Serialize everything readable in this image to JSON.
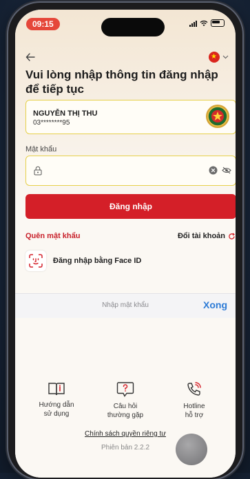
{
  "status_bar": {
    "time": "09:15"
  },
  "header": {
    "language_flag": "vietnam-flag",
    "title": "Vui lòng nhập thông tin đăng nhập để tiếp tục"
  },
  "user": {
    "name": "NGUYỄN THỊ THU",
    "phone_masked": "03********95"
  },
  "password": {
    "label": "Mật khẩu",
    "value": ""
  },
  "login_button": {
    "label": "Đăng nhập"
  },
  "links": {
    "forgot_password": "Quên mật khẩu",
    "switch_account": "Đổi tài khoản"
  },
  "face_id": {
    "label": "Đăng nhập bằng Face ID"
  },
  "keyboard_bar": {
    "hint": "Nhập mật khẩu",
    "done": "Xong"
  },
  "shortcuts": [
    {
      "icon": "book-icon",
      "label": "Hướng dẫn\nsử dụng"
    },
    {
      "icon": "question-bubble-icon",
      "label": "Câu hỏi\nthường gặp"
    },
    {
      "icon": "phone-call-icon",
      "label": "Hotline\nhỗ trợ"
    }
  ],
  "footer": {
    "privacy": "Chính sách quyền riêng tư",
    "version": "Phiên bản 2.2.2"
  },
  "colors": {
    "primary_red": "#d41f28",
    "field_border": "#e6d04a",
    "done_blue": "#2d7bd6"
  }
}
